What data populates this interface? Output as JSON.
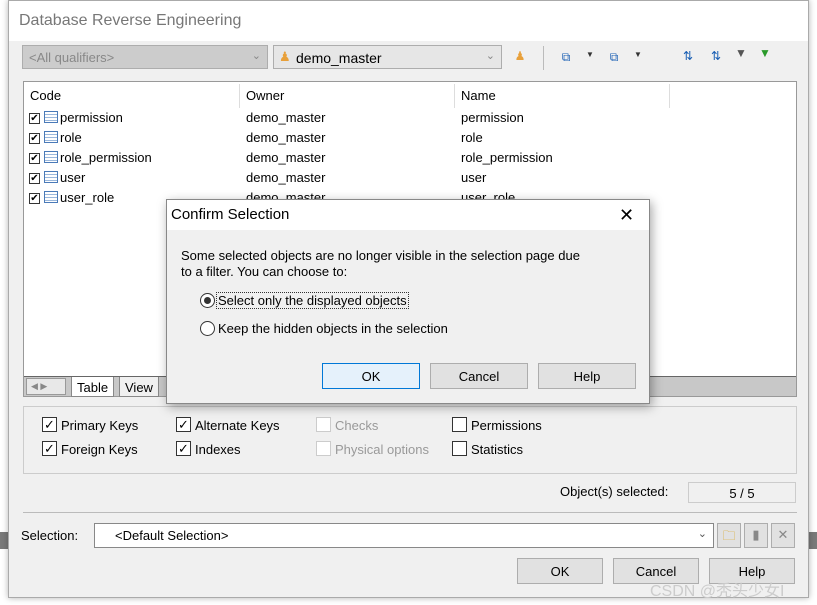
{
  "window": {
    "title": "Database Reverse Engineering"
  },
  "toolbar": {
    "qualifier": "<All qualifiers>",
    "owner": "demo_master",
    "icons": [
      "owner-filter-icon",
      "select-all-icon",
      "dropdown-arrow-icon",
      "deselect-all-icon",
      "dropdown-arrow-icon",
      "move-up-icon",
      "move-down-icon",
      "edit-filter-icon",
      "apply-filter-icon"
    ]
  },
  "list": {
    "columns": [
      "Code",
      "Owner",
      "Name"
    ],
    "rows": [
      {
        "code": "permission",
        "owner": "demo_master",
        "name": "permission",
        "checked": true
      },
      {
        "code": "role",
        "owner": "demo_master",
        "name": "role",
        "checked": true
      },
      {
        "code": "role_permission",
        "owner": "demo_master",
        "name": "role_permission",
        "checked": true
      },
      {
        "code": "user",
        "owner": "demo_master",
        "name": "user",
        "checked": true
      },
      {
        "code": "user_role",
        "owner": "demo_master",
        "name": "user_role",
        "checked": true
      }
    ],
    "tabs": [
      "Table",
      "View"
    ]
  },
  "options": [
    {
      "label": "Primary Keys",
      "checked": true,
      "enabled": true
    },
    {
      "label": "Foreign Keys",
      "checked": true,
      "enabled": true
    },
    {
      "label": "Alternate Keys",
      "checked": true,
      "enabled": true
    },
    {
      "label": "Indexes",
      "checked": true,
      "enabled": true
    },
    {
      "label": "Checks",
      "checked": false,
      "enabled": false
    },
    {
      "label": "Physical options",
      "checked": false,
      "enabled": false
    },
    {
      "label": "Permissions",
      "checked": false,
      "enabled": true
    },
    {
      "label": "Statistics",
      "checked": false,
      "enabled": true
    }
  ],
  "selected": {
    "label": "Object(s) selected:",
    "value": "5 / 5"
  },
  "selection": {
    "label": "Selection:",
    "value": "<Default Selection>"
  },
  "buttons": {
    "ok": "OK",
    "cancel": "Cancel",
    "help": "Help"
  },
  "dialog": {
    "title": "Confirm Selection",
    "message_line1": "Some selected objects are no longer visible in the selection page due",
    "message_line2": "to a filter. You can choose to:",
    "option1": "Select only the displayed objects",
    "option2": "Keep the hidden objects in the selection",
    "selected_option": 1,
    "ok": "OK",
    "cancel": "Cancel",
    "help": "Help"
  },
  "watermark": "CSDN @秃头少女I"
}
